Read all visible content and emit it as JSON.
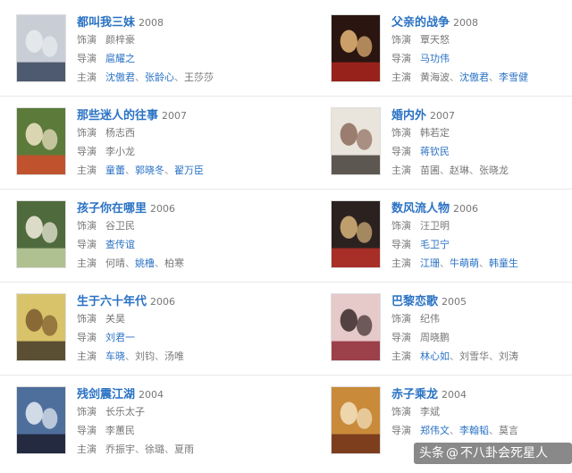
{
  "labels": {
    "role": "饰演",
    "director": "导演",
    "cast": "主演"
  },
  "rows": [
    {
      "left": {
        "title": "都叫我三妹",
        "year": "2008",
        "role": "颜梓豪",
        "director": [
          {
            "name": "扈耀之",
            "link": true
          }
        ],
        "cast": [
          {
            "name": "沈傲君",
            "link": true
          },
          {
            "name": "张龄心",
            "link": true
          },
          {
            "name": "王莎莎",
            "link": false
          }
        ],
        "poster": {
          "bg": "#c9ced6",
          "accent": "#2f3d55",
          "fg": "#e9ecef"
        }
      },
      "right": {
        "title": "父亲的战争",
        "year": "2008",
        "role": "覃天怒",
        "director": [
          {
            "name": "马功伟",
            "link": true
          }
        ],
        "cast": [
          {
            "name": "黄海波",
            "link": false
          },
          {
            "name": "沈傲君",
            "link": true
          },
          {
            "name": "李雪健",
            "link": true
          }
        ],
        "poster": {
          "bg": "#2a1510",
          "accent": "#b3261e",
          "fg": "#e8b878"
        }
      }
    },
    {
      "left": {
        "title": "那些迷人的往事",
        "year": "2007",
        "role": "杨志西",
        "director": [
          {
            "name": "李小龙",
            "link": false
          }
        ],
        "cast": [
          {
            "name": "童蕾",
            "link": true
          },
          {
            "name": "郭晓冬",
            "link": true
          },
          {
            "name": "翟万臣",
            "link": true
          }
        ],
        "poster": {
          "bg": "#5c7a3a",
          "accent": "#d94a2a",
          "fg": "#f1e6c8"
        }
      },
      "right": {
        "title": "婚内外",
        "year": "2007",
        "role": "韩若定",
        "director": [
          {
            "name": "蒋钦民",
            "link": true
          }
        ],
        "cast": [
          {
            "name": "苗圃",
            "link": false
          },
          {
            "name": "赵琳",
            "link": false
          },
          {
            "name": "张晓龙",
            "link": false
          }
        ],
        "poster": {
          "bg": "#e9e4dc",
          "accent": "#3a3330",
          "fg": "#8c6b5a"
        }
      }
    },
    {
      "left": {
        "title": "孩子你在哪里",
        "year": "2006",
        "role": "谷卫民",
        "director": [
          {
            "name": "查传谊",
            "link": true
          }
        ],
        "cast": [
          {
            "name": "何晴",
            "link": false
          },
          {
            "name": "姚橹",
            "link": true
          },
          {
            "name": "柏寒",
            "link": false
          }
        ],
        "poster": {
          "bg": "#4f6b3d",
          "accent": "#c7d6a6",
          "fg": "#f3efe1"
        }
      },
      "right": {
        "title": "数风流人物",
        "year": "2006",
        "role": "汪卫明",
        "director": [
          {
            "name": "毛卫宁",
            "link": true
          }
        ],
        "cast": [
          {
            "name": "江珊",
            "link": true
          },
          {
            "name": "牛萌萌",
            "link": true
          },
          {
            "name": "韩童生",
            "link": true
          }
        ],
        "poster": {
          "bg": "#2b2220",
          "accent": "#c8322a",
          "fg": "#d9b47c"
        }
      }
    },
    {
      "left": {
        "title": "生于六十年代",
        "year": "2006",
        "role": "关昊",
        "director": [
          {
            "name": "刘君一",
            "link": true
          }
        ],
        "cast": [
          {
            "name": "车晓",
            "link": true
          },
          {
            "name": "刘钧",
            "link": false
          },
          {
            "name": "汤唯",
            "link": false
          }
        ],
        "poster": {
          "bg": "#d9c36a",
          "accent": "#3b3226",
          "fg": "#7a5a2e"
        }
      },
      "right": {
        "title": "巴黎恋歌",
        "year": "2005",
        "role": "纪伟",
        "director": [
          {
            "name": "周晓鹏",
            "link": false
          }
        ],
        "cast": [
          {
            "name": "林心如",
            "link": true
          },
          {
            "name": "刘雪华",
            "link": false
          },
          {
            "name": "刘涛",
            "link": false
          }
        ],
        "poster": {
          "bg": "#e6c9c9",
          "accent": "#8a1e2b",
          "fg": "#3a2a2a"
        }
      }
    },
    {
      "left": {
        "title": "残剑震江湖",
        "year": "2004",
        "role": "长乐太子",
        "director": [
          {
            "name": "李蕙民",
            "link": false
          }
        ],
        "cast": [
          {
            "name": "乔振宇",
            "link": false
          },
          {
            "name": "徐璐",
            "link": false
          },
          {
            "name": "夏雨",
            "link": false
          }
        ],
        "poster": {
          "bg": "#4e6f9c",
          "accent": "#1a1a2a",
          "fg": "#e8eef5"
        }
      },
      "right": {
        "title": "赤子乘龙",
        "year": "2004",
        "role": "李斌",
        "director": [
          {
            "name": "郑伟文",
            "link": true
          },
          {
            "name": "李翰韬",
            "link": true
          },
          {
            "name": "莫言",
            "link": false
          }
        ],
        "cast": [],
        "poster": {
          "bg": "#c98a3a",
          "accent": "#6a2a18",
          "fg": "#f4e2c0"
        }
      }
    }
  ],
  "watermark": {
    "prefix": "头条",
    "at": "@",
    "name": "不八卦会死星人"
  }
}
